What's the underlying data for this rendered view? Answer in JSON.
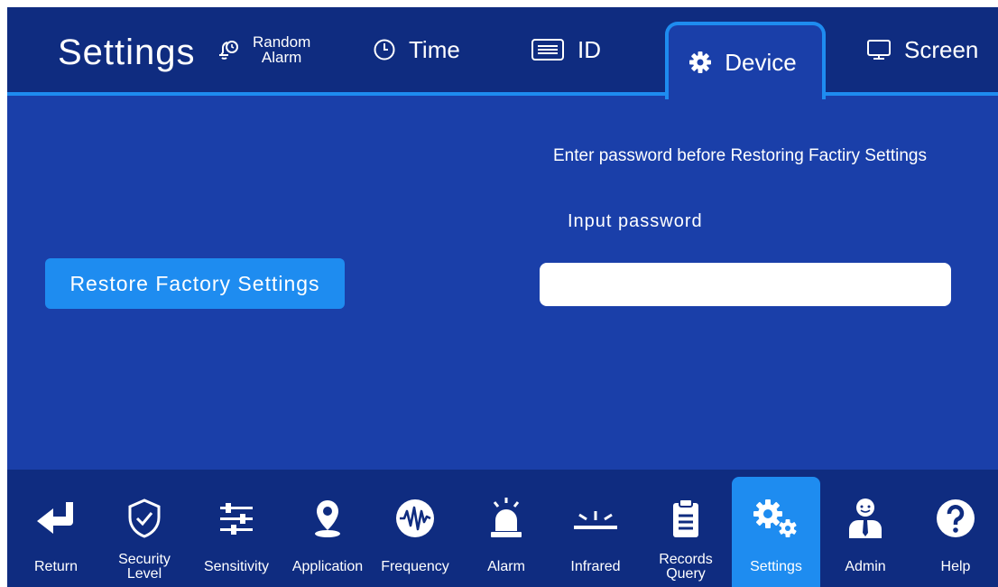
{
  "header": {
    "title": "Settings",
    "tabs": [
      {
        "line1": "Random",
        "line2": "Alarm",
        "icon": "alarm-bell-icon"
      },
      {
        "label": "Time",
        "icon": "clock-icon"
      },
      {
        "label": "ID",
        "icon": "id-card-icon"
      },
      {
        "label": "Device",
        "icon": "gear-icon",
        "active": true
      },
      {
        "label": "Screen",
        "icon": "monitor-icon"
      }
    ]
  },
  "main": {
    "restore_button": "Restore Factory Settings",
    "notice": "Enter password before Restoring Factiry Settings",
    "password_label": "Input password",
    "password_value": ""
  },
  "nav": [
    {
      "label": "Return",
      "icon": "return-arrow-icon"
    },
    {
      "line1": "Security",
      "line2": "Level",
      "icon": "shield-check-icon"
    },
    {
      "label": "Sensitivity",
      "icon": "sliders-icon"
    },
    {
      "label": "Application",
      "icon": "location-pin-icon"
    },
    {
      "label": "Frequency",
      "icon": "waveform-icon"
    },
    {
      "label": "Alarm",
      "icon": "siren-icon"
    },
    {
      "label": "Infrared",
      "icon": "infrared-icon"
    },
    {
      "line1": "Records",
      "line2": "Query",
      "icon": "clipboard-icon"
    },
    {
      "label": "Settings",
      "icon": "gears-icon",
      "active": true
    },
    {
      "label": "Admin",
      "icon": "admin-person-icon"
    },
    {
      "label": "Help",
      "icon": "help-icon"
    }
  ],
  "colors": {
    "background": "#1a3fa9",
    "bar": "#0f2c80",
    "accent": "#1e8cf0",
    "text": "#ffffff"
  }
}
